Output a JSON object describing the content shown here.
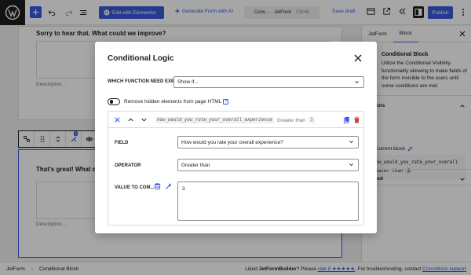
{
  "toolbar": {
    "elementor_label": "Edit with Elementor",
    "generate_label": "Generate Form with AI",
    "command_title": "Conv… · JetForm",
    "command_shortcut": "Ctrl+K",
    "save_draft_label": "Save draft",
    "publish_label": "Publish"
  },
  "canvas": {
    "card1_title": "Sorry to hear that. What could we improve?",
    "card1_desc": "Description...",
    "card2_title": "That's great! What di",
    "card2_desc": "Description...",
    "block_count_badge": "1"
  },
  "sidebar": {
    "tab_form": "JetForm",
    "tab_block": "Block",
    "block_name": "Conditional Block",
    "block_desc": "Utilize the Conditional Visibility functionality allowing to make fields of the form invisible to the users until some conditions are met.",
    "conditions_title": "ditions",
    "edit_label": "ew current block",
    "code_field": "how_would_you_rate_your_overall",
    "code_op": "reater than",
    "code_val": "3",
    "advanced_title": "anced"
  },
  "modal": {
    "title": "Conditional Logic",
    "function_label": "WHICH FUNCTION NEED EXE...",
    "function_value": "Show if...",
    "toggle_label": "Remove hidden elements from page HTML",
    "help_glyph": "?",
    "condition": {
      "field_code": "how_would_you_rate_your_overall_experience",
      "operator_text": "Greater than",
      "value_text": "3",
      "field_label": "FIELD",
      "field_value": "How would you rate your overall experience?",
      "operator_label": "OPERATOR",
      "operator_value": "Greater than",
      "value_label": "VALUE TO COM...",
      "value_value": "3"
    }
  },
  "statusbar": {
    "crumb1": "JetForm",
    "crumb2": "Conditional Block",
    "liked_pre": "Liked",
    "brand": "JetFormBuilder",
    "please": "? Please",
    "rate_link": "rate it ★★★★★",
    "support_pre": ". For troubleshooting, contact",
    "support_link": "Crocoblock support"
  },
  "colors": {
    "accent": "#3858e9",
    "dark": "#1e1e1e",
    "danger": "#d63638"
  },
  "icons": [
    "wordpress-logo-icon",
    "plus-icon",
    "undo-icon",
    "redo-icon",
    "list-view-icon",
    "elementor-icon",
    "sparkle-icon",
    "preview-icon",
    "external-link-icon",
    "chevrons-left-icon",
    "settings-panel-icon",
    "more-vertical-icon",
    "close-icon",
    "chevron-up-icon",
    "chevron-down-icon",
    "copy-icon",
    "trash-icon",
    "database-icon",
    "wrench-icon",
    "pencil-icon"
  ]
}
